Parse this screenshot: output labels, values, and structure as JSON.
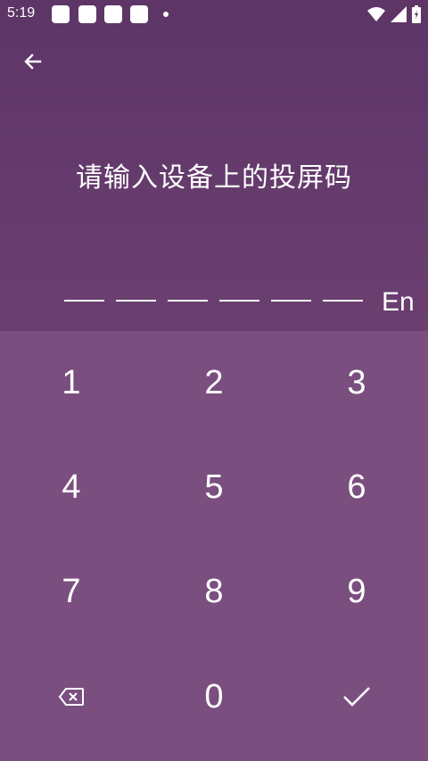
{
  "status_bar": {
    "time": "5:19",
    "icons": [
      "notification-icon",
      "notification-icon",
      "notification-icon",
      "notification-icon",
      "dot-icon",
      "wifi-icon",
      "signal-icon",
      "battery-icon"
    ]
  },
  "header": {
    "back_icon": "arrow-left-icon",
    "title": "请输入设备上的投屏码"
  },
  "code_input": {
    "slot_count": 6,
    "language_toggle": "En"
  },
  "keypad": {
    "keys": [
      "1",
      "2",
      "3",
      "4",
      "5",
      "6",
      "7",
      "8",
      "9",
      "0"
    ],
    "backspace_icon": "backspace-icon",
    "confirm_icon": "check-icon"
  },
  "colors": {
    "header_bg": "#5d3566",
    "keypad_bg": "#7a4f7f",
    "foreground": "#ffffff"
  }
}
